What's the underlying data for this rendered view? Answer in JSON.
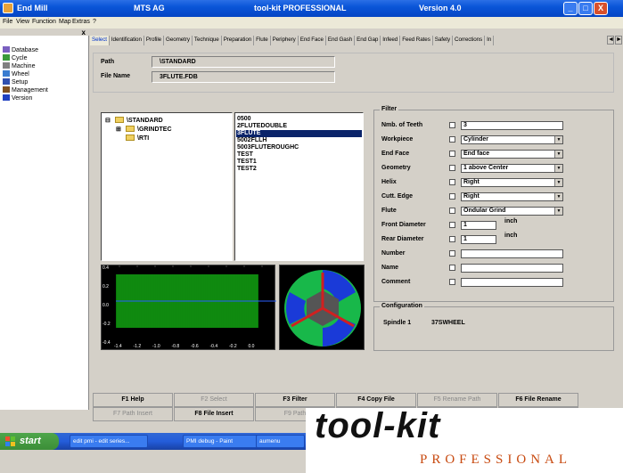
{
  "window": {
    "title_left": "End Mill",
    "title_company": "MTS AG",
    "title_product": "tool-kit PROFESSIONAL",
    "title_version": "Version 4.0",
    "btn_min": "_",
    "btn_max": "□",
    "btn_close": "X"
  },
  "menu": [
    "File",
    "View",
    "Function",
    "Map",
    "Extras",
    "?"
  ],
  "sidebar": {
    "close": "x",
    "items": [
      {
        "label": "Database",
        "icon": "database-icon",
        "color": "#7a5fc0"
      },
      {
        "label": "Cycle",
        "icon": "cycle-icon",
        "color": "#3a9a3a"
      },
      {
        "label": "Machine",
        "icon": "machine-icon",
        "color": "#808080"
      },
      {
        "label": "Wheel",
        "icon": "wheel-icon",
        "color": "#3a7cd0"
      },
      {
        "label": "Setup",
        "icon": "setup-icon",
        "color": "#3050b0"
      },
      {
        "label": "Management",
        "icon": "management-icon",
        "color": "#805020"
      },
      {
        "label": "Version",
        "icon": "version-icon",
        "color": "#2040c0"
      }
    ]
  },
  "tabs": [
    "Select",
    "Identification",
    "Profile",
    "Geometry",
    "Technique",
    "Preparation",
    "Flute",
    "Periphery",
    "End Face",
    "End Gash",
    "End Gap",
    "Infeed",
    "Feed Rates",
    "Safety",
    "Corrections",
    "In"
  ],
  "tab_nav": {
    "left": "◄",
    "right": "►"
  },
  "path": {
    "path_label": "Path",
    "path_value": "\\STANDARD",
    "file_label": "File Name",
    "file_value": "3FLUTE.FDB"
  },
  "tree": [
    {
      "label": "\\STANDARD",
      "expander": "⊟"
    },
    {
      "label": "\\GRINDTEC",
      "expander": "⊞"
    },
    {
      "label": "\\RTI",
      "expander": ""
    }
  ],
  "files": [
    "0500",
    "2FLUTEDOUBLE",
    "3FLUTE",
    "5002FLLH",
    "5003FLUTEROUGHC",
    "TEST",
    "TEST1",
    "TEST2"
  ],
  "selected_file": "3FLUTE",
  "preview": {
    "y_ticks": [
      "0.4",
      "0.2",
      "0.0",
      "-0.2",
      "-0.4"
    ],
    "x_ticks": [
      "-1.4",
      "-1.2",
      "-1.0",
      "-0.8",
      "-0.6",
      "-0.4",
      "-0.2",
      "0.0"
    ]
  },
  "filter": {
    "title": "Filter",
    "rows": [
      {
        "label": "Nmb. of Teeth",
        "kind": "text",
        "value": "3",
        "unit": ""
      },
      {
        "label": "Workpiece",
        "kind": "select",
        "value": "Cylinder",
        "unit": ""
      },
      {
        "label": "End Face",
        "kind": "select",
        "value": "End face",
        "unit": ""
      },
      {
        "label": "Geometry",
        "kind": "select",
        "value": "1 above Center",
        "unit": ""
      },
      {
        "label": "Helix",
        "kind": "select",
        "value": "Right",
        "unit": ""
      },
      {
        "label": "Cutt. Edge",
        "kind": "select",
        "value": "Right",
        "unit": ""
      },
      {
        "label": "Flute",
        "kind": "select",
        "value": "Ondular Grind",
        "unit": ""
      },
      {
        "label": "Front Diameter",
        "kind": "text",
        "value": "1",
        "unit": "inch"
      },
      {
        "label": "Rear Diameter",
        "kind": "text",
        "value": "1",
        "unit": "inch"
      },
      {
        "label": "Number",
        "kind": "text",
        "value": "",
        "unit": ""
      },
      {
        "label": "Name",
        "kind": "text",
        "value": "",
        "unit": ""
      },
      {
        "label": "Comment",
        "kind": "text",
        "value": "",
        "unit": ""
      }
    ]
  },
  "configuration": {
    "title": "Configuration",
    "label": "Spindle 1",
    "value": "37SWHEEL"
  },
  "fkeys_row1": [
    {
      "label": "F1 Help",
      "enabled": true
    },
    {
      "label": "F2 Select",
      "enabled": false
    },
    {
      "label": "F3 Filter",
      "enabled": true
    },
    {
      "label": "F4 Copy File",
      "enabled": true
    },
    {
      "label": "F5 Rename Path",
      "enabled": false
    },
    {
      "label": "F6 File Rename",
      "enabled": true
    }
  ],
  "fkeys_row2": [
    {
      "label": "F7 Path Insert",
      "enabled": false
    },
    {
      "label": "F8 File Insert",
      "enabled": true
    },
    {
      "label": "F9 Path",
      "enabled": false
    },
    {
      "label": "",
      "enabled": true
    },
    {
      "label": "",
      "enabled": false
    },
    {
      "label": "",
      "enabled": false
    }
  ],
  "taskbar": {
    "start": "start",
    "items": [
      "edit pmi - edit series...",
      "PMI debug - Paint",
      "aumenu"
    ]
  },
  "logo": {
    "main": "tool-kit",
    "sub": "PROFESSIONAL"
  }
}
